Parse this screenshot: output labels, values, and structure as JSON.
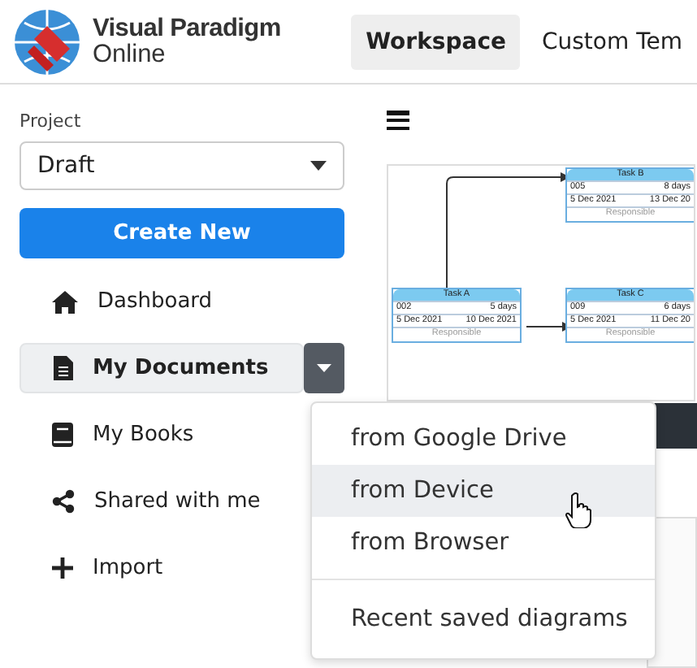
{
  "header": {
    "logo": {
      "line1": "Visual Paradigm",
      "line2": "Online"
    },
    "tabs": [
      {
        "label": "Workspace",
        "selected": true
      },
      {
        "label": "Custom Tem",
        "selected": false
      }
    ]
  },
  "sidebar": {
    "project_label": "Project",
    "project_value": "Draft",
    "create_button": "Create New",
    "items": [
      {
        "label": "Dashboard",
        "selected": false,
        "has_menu": false
      },
      {
        "label": "My Documents",
        "selected": true,
        "has_menu": true
      },
      {
        "label": "My Books",
        "selected": false,
        "has_menu": false
      },
      {
        "label": "Shared with me",
        "selected": false,
        "has_menu": false
      },
      {
        "label": "Import",
        "selected": false,
        "has_menu": false
      }
    ]
  },
  "diagram_nodes": [
    {
      "title": "Task B",
      "id": "005",
      "duration": "8 days",
      "start": "5 Dec 2021",
      "end": "13 Dec 20",
      "footer": "Responsible"
    },
    {
      "title": "Task A",
      "id": "002",
      "duration": "5 days",
      "start": "5 Dec 2021",
      "end": "10 Dec 2021",
      "footer": "Responsible"
    },
    {
      "title": "Task C",
      "id": "009",
      "duration": "6 days",
      "start": "5 Dec 2021",
      "end": "11 Dec 20",
      "footer": "Responsible"
    }
  ],
  "dropdown": {
    "items": [
      {
        "label": "from Google Drive",
        "selected": false
      },
      {
        "label": "from Device",
        "selected": true
      },
      {
        "label": "from Browser",
        "selected": false
      }
    ],
    "footer_item": "Recent saved diagrams"
  }
}
